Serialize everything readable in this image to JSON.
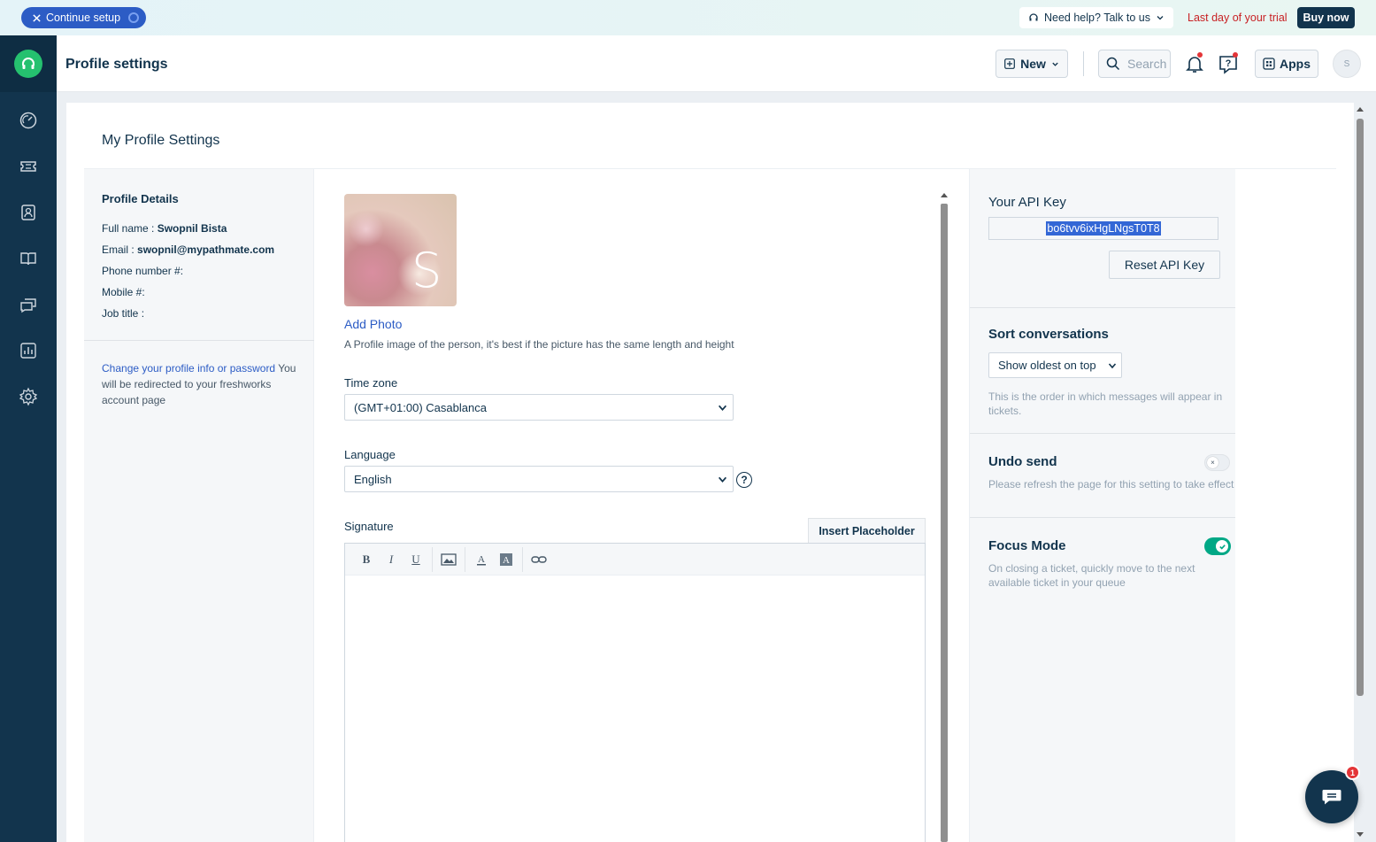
{
  "banner": {
    "setup_label": "Continue setup",
    "help_label": "Need help? Talk to us",
    "trial_text": "Last day of your trial",
    "buy_label": "Buy now"
  },
  "sidebar": {
    "items": [
      {
        "icon": "dashboard-icon"
      },
      {
        "icon": "tickets-icon"
      },
      {
        "icon": "contacts-icon"
      },
      {
        "icon": "solutions-icon"
      },
      {
        "icon": "forums-icon"
      },
      {
        "icon": "reports-icon"
      },
      {
        "icon": "admin-gear-icon"
      }
    ]
  },
  "header": {
    "title": "Profile settings",
    "new_label": "New",
    "search_placeholder": "Search",
    "apps_label": "Apps",
    "avatar_initial": "S"
  },
  "page": {
    "title": "My Profile Settings"
  },
  "profile": {
    "section_title": "Profile Details",
    "full_name_label": "Full name :",
    "full_name": "Swopnil Bista",
    "email_label": "Email :",
    "email": "swopnil@mypathmate.com",
    "phone_label": "Phone number #:",
    "mobile_label": "Mobile #:",
    "job_title_label": "Job title :",
    "change_link": "Change your profile info or password",
    "change_note": "You will be redirected to your freshworks account page"
  },
  "form": {
    "photo_initial": "S",
    "add_photo": "Add Photo",
    "photo_hint": "A Profile image of the person, it's best if the picture has the same length and height",
    "timezone_label": "Time zone",
    "timezone_value": "(GMT+01:00) Casablanca",
    "language_label": "Language",
    "language_value": "English",
    "signature_label": "Signature",
    "insert_placeholder": "Insert Placeholder"
  },
  "settings": {
    "api_title": "Your API Key",
    "api_key": "bo6tvv6ixHgLNgsT0T8",
    "reset_label": "Reset API Key",
    "sort_title": "Sort conversations",
    "sort_value": "Show oldest on top",
    "sort_desc": "This is the order in which messages will appear in tickets.",
    "undo_title": "Undo send",
    "undo_desc": "Please refresh the page for this setting to take effect",
    "undo_enabled": false,
    "focus_title": "Focus Mode",
    "focus_desc": "On closing a ticket, quickly move to the next available ticket in your queue",
    "focus_enabled": true
  },
  "chat": {
    "badge_count": "1"
  },
  "colors": {
    "sidebar": "#12344d",
    "accent": "#2c5cc5",
    "brand_green": "#25c16f",
    "toggle_on": "#00a886",
    "trial_red": "#c82124"
  }
}
